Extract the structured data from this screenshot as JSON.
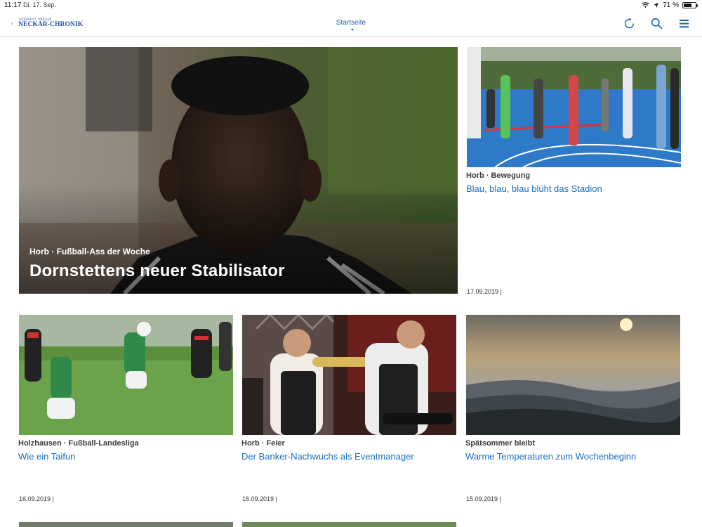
{
  "status": {
    "time": "11:17",
    "date": "Di. 17. Sep.",
    "battery": "71 %",
    "battery_level": 0.71
  },
  "nav": {
    "logo_sup": "SÜDWEST PRESSE",
    "logo_main": "NECKAR-CHRONIK",
    "title": "Startseite",
    "icons": [
      "refresh-icon",
      "search-icon",
      "menu-icon"
    ]
  },
  "hero": {
    "meta": "Horb · Fußball-Ass der Woche",
    "title": "Dornstettens neuer Stabilisator"
  },
  "articles": [
    {
      "meta": "Horb · Bewegung",
      "title": "Blau, blau, blau blüht das Stadion",
      "date": "17.09.2019 |"
    },
    {
      "meta": "Holzhausen · Fußball-Landesliga",
      "title": "Wie ein Taifun",
      "date": "16.09.2019 |"
    },
    {
      "meta": "Horb · Feier",
      "title": "Der Banker-Nachwuchs als Eventmanager",
      "date": "16.09.2019 |"
    },
    {
      "meta": "Spätsommer bleibt",
      "title": "Warme Temperaturen zum Wochenbeginn",
      "date": "15.09.2019 |"
    }
  ],
  "colors": {
    "accent": "#1a6dbf",
    "logo": "#1f4f9c"
  }
}
